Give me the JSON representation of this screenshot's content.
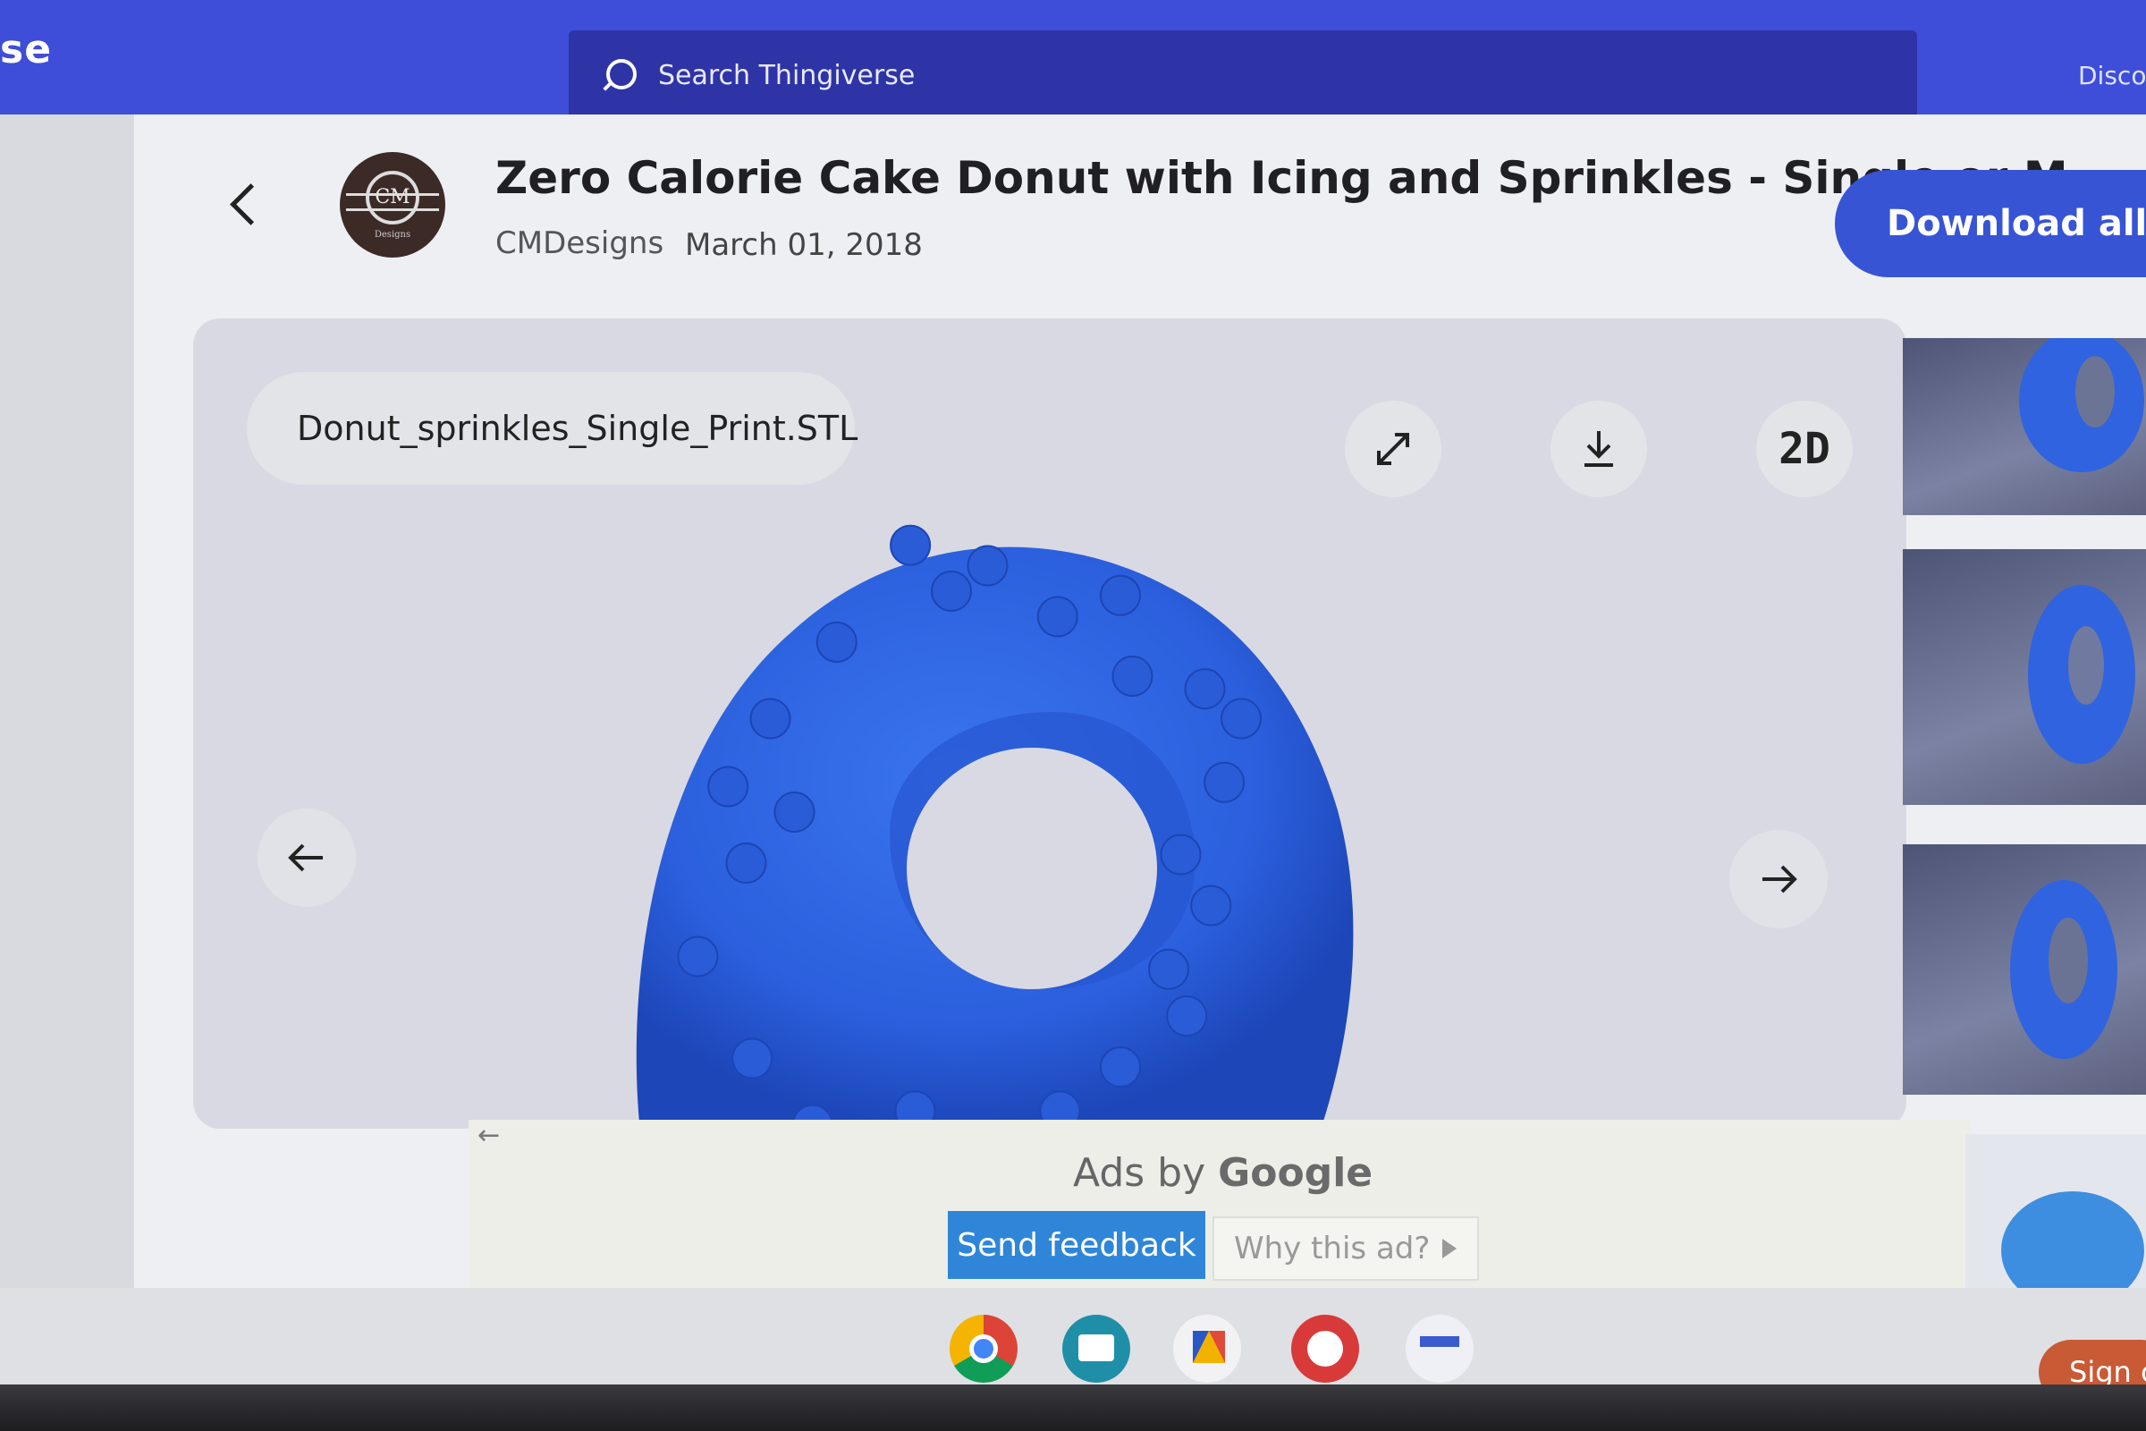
{
  "nav": {
    "brand_fragment": "se",
    "search_placeholder": "Search Thingiverse",
    "discover_fragment": "Disco"
  },
  "thing": {
    "title": "Zero Calorie Cake Donut with Icing and Sprinkles - Single or M...",
    "author": "CMDesigns",
    "date": "March 01, 2018",
    "download_all_label": "Download all fil",
    "avatar_text": "CM",
    "avatar_subtext": "Designs"
  },
  "viewer": {
    "file_name": "Donut_sprinkles_Single_Print.STL",
    "mode_label": "2D",
    "model_color": "#2f63e0"
  },
  "ad": {
    "label_prefix": "Ads by",
    "label_brand": "Google",
    "back_glyph": "←",
    "send_feedback": "Send feedback",
    "why_this_ad": "Why this ad?"
  },
  "shelf": {
    "apps": [
      "chrome-icon",
      "classroom-icon",
      "drawing-app-icon",
      "paint-app-icon",
      "docs-app-icon"
    ],
    "sign_in_fragment": "Sign c"
  },
  "colors": {
    "nav_blue": "#3f4ed8",
    "search_bg": "#2e34a6",
    "download_blue": "#3754d4",
    "feedback_blue": "#2f86d8",
    "sign_in_orange": "#c85a35"
  }
}
